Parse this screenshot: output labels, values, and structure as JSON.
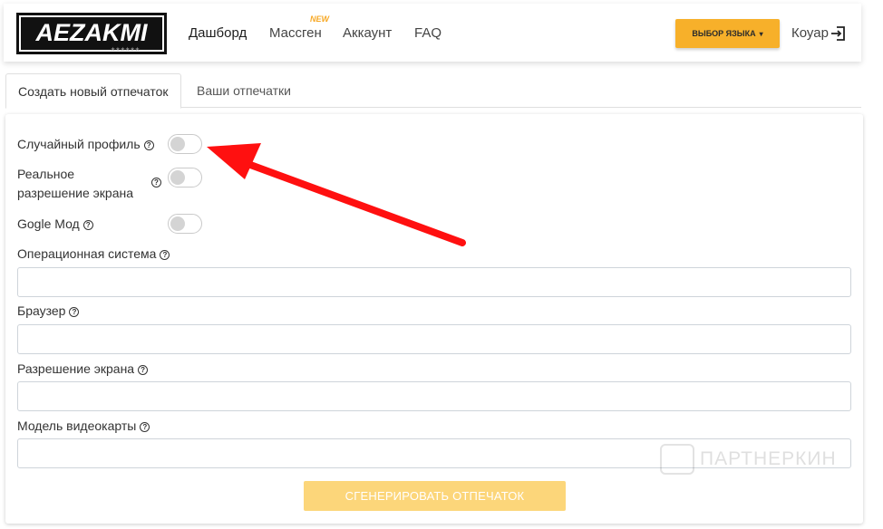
{
  "navbar": {
    "logo_text": "AEZAKMI",
    "links": [
      {
        "label": "Дашборд",
        "active": true
      },
      {
        "label": "Массген",
        "badge": "NEW"
      },
      {
        "label": "Аккаунт"
      },
      {
        "label": "FAQ"
      }
    ],
    "lang_button": "ВЫБОР ЯЗЫКА",
    "user_name": "Коуар"
  },
  "tabs": [
    {
      "label": "Создать новый отпечаток",
      "active": true
    },
    {
      "label": "Ваши отпечатки",
      "active": false
    }
  ],
  "form": {
    "random_profile": {
      "label": "Случайный профиль",
      "help": "?",
      "enabled": false
    },
    "real_resolution": {
      "label_line1": "Реальное",
      "label_line2": "разрешение экрана",
      "help": "?",
      "enabled": false
    },
    "google_mode": {
      "label": "Gogle Мод",
      "help": "?",
      "enabled": false
    },
    "os": {
      "label": "Операционная система",
      "help": "?",
      "value": ""
    },
    "browser": {
      "label": "Браузер",
      "help": "?",
      "value": ""
    },
    "resolution": {
      "label": "Разрешение экрана",
      "help": "?",
      "value": ""
    },
    "gpu": {
      "label": "Модель видеокарты",
      "help": "?",
      "value": ""
    },
    "generate_button": "СГЕНЕРИРОВАТЬ ОТПЕЧАТОК"
  },
  "watermark": "ПАРТНЕРКИН",
  "colors": {
    "accent": "#f7b02a",
    "arrow": "#ff0000",
    "button_disabled": "#fcd67a"
  }
}
